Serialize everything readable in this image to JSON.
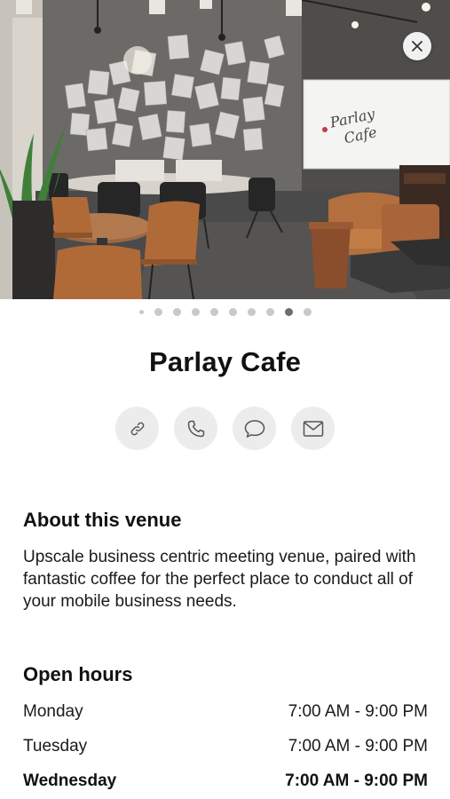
{
  "venue": {
    "name": "Parlay Cafe",
    "photo_count": 10,
    "current_photo_index": 8
  },
  "photo": {
    "whiteboard_text_line1": "Parlay",
    "whiteboard_text_line2": "Cafe"
  },
  "actions": [
    {
      "icon": "link-icon"
    },
    {
      "icon": "phone-icon"
    },
    {
      "icon": "message-icon"
    },
    {
      "icon": "mail-icon"
    }
  ],
  "about": {
    "heading": "About this venue",
    "body": "Upscale business centric meeting venue, paired with fantastic coffee for the perfect place to conduct all of your mobile business needs."
  },
  "hours": {
    "heading": "Open hours",
    "days": [
      {
        "day": "Monday",
        "time": "7:00 AM - 9:00 PM"
      },
      {
        "day": "Tuesday",
        "time": "7:00 AM - 9:00 PM"
      },
      {
        "day": "Wednesday",
        "time": "7:00 AM - 9:00 PM",
        "current": true
      }
    ]
  },
  "colors": {
    "accent_button_bg": "#ececec",
    "dot_inactive": "#c9c9c9",
    "dot_active": "#6e6e6e"
  }
}
